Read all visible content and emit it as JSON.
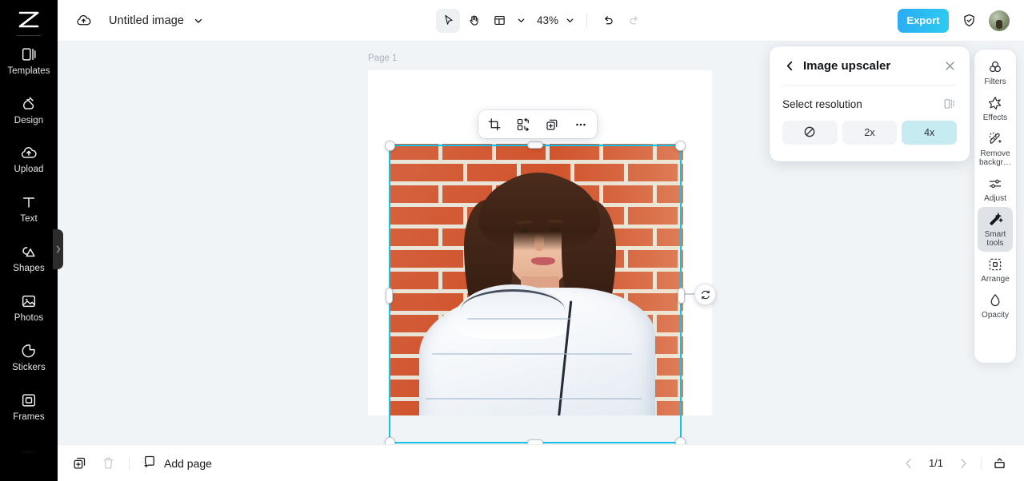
{
  "left_rail": {
    "logo": "capcut-logo",
    "items": [
      {
        "label": "Templates",
        "icon": "templates-icon"
      },
      {
        "label": "Design",
        "icon": "design-icon"
      },
      {
        "label": "Upload",
        "icon": "upload-icon"
      },
      {
        "label": "Text",
        "icon": "text-icon"
      },
      {
        "label": "Shapes",
        "icon": "shapes-icon"
      },
      {
        "label": "Photos",
        "icon": "photos-icon"
      },
      {
        "label": "Stickers",
        "icon": "stickers-icon"
      },
      {
        "label": "Frames",
        "icon": "frames-icon"
      }
    ]
  },
  "topbar": {
    "cloud_icon": "cloud-upload-icon",
    "doc_title": "Untitled image",
    "title_caret": "chevron-down-icon",
    "tools": {
      "select": "cursor-arrow-icon",
      "hand": "hand-icon",
      "layout": "layout-icon",
      "layout_caret": "chevron-down-icon",
      "zoom_value": "43%",
      "zoom_caret": "chevron-down-icon",
      "undo": "undo-icon",
      "redo": "redo-icon"
    },
    "export_label": "Export",
    "shield_icon": "shield-check-icon",
    "avatar": "user-avatar"
  },
  "canvas": {
    "page_label": "Page 1",
    "context_toolbar": [
      {
        "name": "crop-icon"
      },
      {
        "name": "replace-image-icon"
      },
      {
        "name": "duplicate-icon"
      },
      {
        "name": "more-options-icon"
      }
    ],
    "rotate_handle": "rotate-icon",
    "selected_object": "photo-of-woman-against-brick-wall"
  },
  "upscaler": {
    "back_icon": "chevron-left-icon",
    "title": "Image upscaler",
    "close_icon": "close-icon",
    "section_label": "Select resolution",
    "compare_icon": "compare-preview-icon",
    "options": [
      {
        "label": "",
        "icon": "none-prohibited-icon",
        "selected": false
      },
      {
        "label": "2x",
        "icon": "",
        "selected": false
      },
      {
        "label": "4x",
        "icon": "",
        "selected": true
      }
    ],
    "selected_color": "#c6ecf2"
  },
  "right_rail": {
    "items": [
      {
        "label": "Filters",
        "icon": "filters-icon",
        "active": false
      },
      {
        "label": "Effects",
        "icon": "effects-icon",
        "active": false
      },
      {
        "label": "Remove\nbackgr…",
        "icon": "remove-bg-icon",
        "active": false
      },
      {
        "label": "Adjust",
        "icon": "adjust-icon",
        "active": false
      },
      {
        "label": "Smart\ntools",
        "icon": "smart-tools-icon",
        "active": true
      },
      {
        "label": "Arrange",
        "icon": "arrange-icon",
        "active": false
      },
      {
        "label": "Opacity",
        "icon": "opacity-icon",
        "active": false
      }
    ]
  },
  "bottombar": {
    "duplicate_page_icon": "duplicate-page-icon",
    "delete_page_icon": "trash-icon",
    "add_page_label": "Add page",
    "add_page_icon": "add-page-icon",
    "prev_icon": "chevron-left-icon",
    "page_indicator": "1/1",
    "next_icon": "chevron-right-icon",
    "present_icon": "present-icon"
  },
  "colors": {
    "accent": "#12c2e9",
    "export_gradient_from": "#2aabf5",
    "export_gradient_to": "#2ecbf0",
    "canvas_bg": "#f1f4f7",
    "rail_bg": "#000000"
  }
}
